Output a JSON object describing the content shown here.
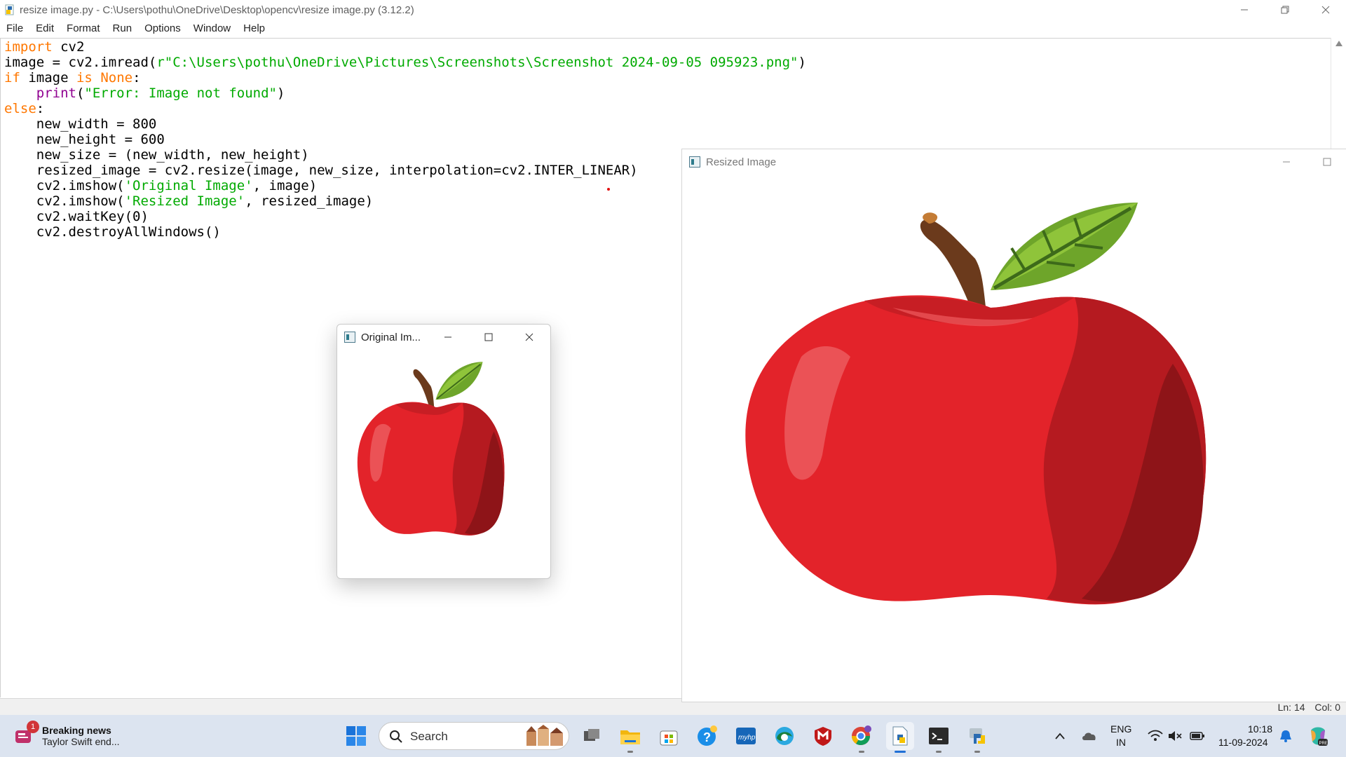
{
  "window": {
    "title": "resize image.py - C:\\Users\\pothu\\OneDrive\\Desktop\\opencv\\resize image.py (3.12.2)"
  },
  "menu": {
    "items": [
      "File",
      "Edit",
      "Format",
      "Run",
      "Options",
      "Window",
      "Help"
    ]
  },
  "editor": {
    "lines": [
      [
        {
          "t": "kw",
          "v": "import"
        },
        {
          "t": "",
          "v": " cv2"
        }
      ],
      [
        {
          "t": "",
          "v": "image = cv2.imread("
        },
        {
          "t": "str",
          "v": "r\"C:\\Users\\pothu\\OneDrive\\Pictures\\Screenshots\\Screenshot 2024-09-05 095923.png\""
        },
        {
          "t": "",
          "v": ")"
        }
      ],
      [
        {
          "t": "kw",
          "v": "if"
        },
        {
          "t": "",
          "v": " image "
        },
        {
          "t": "kw",
          "v": "is"
        },
        {
          "t": "",
          "v": " "
        },
        {
          "t": "kw",
          "v": "None"
        },
        {
          "t": "",
          "v": ":"
        }
      ],
      [
        {
          "t": "",
          "v": "    "
        },
        {
          "t": "bi",
          "v": "print"
        },
        {
          "t": "",
          "v": "("
        },
        {
          "t": "str",
          "v": "\"Error: Image not found\""
        },
        {
          "t": "",
          "v": ")"
        }
      ],
      [
        {
          "t": "kw",
          "v": "else"
        },
        {
          "t": "",
          "v": ":"
        }
      ],
      [
        {
          "t": "",
          "v": "    new_width = 800"
        }
      ],
      [
        {
          "t": "",
          "v": "    new_height = 600"
        }
      ],
      [
        {
          "t": "",
          "v": "    new_size = (new_width, new_height)"
        }
      ],
      [
        {
          "t": "",
          "v": "    resized_image = cv2.resize(image, new_size, interpolation=cv2.INTER_LINEAR)"
        }
      ],
      [
        {
          "t": "",
          "v": "    cv2.imshow("
        },
        {
          "t": "str",
          "v": "'Original Image'"
        },
        {
          "t": "",
          "v": ", image)"
        }
      ],
      [
        {
          "t": "",
          "v": "    cv2.imshow("
        },
        {
          "t": "str",
          "v": "'Resized Image'"
        },
        {
          "t": "",
          "v": ", resized_image)"
        }
      ],
      [
        {
          "t": "",
          "v": "    cv2.waitKey(0)"
        }
      ],
      [
        {
          "t": "",
          "v": "    cv2.destroyAllWindows()"
        }
      ]
    ]
  },
  "status": {
    "line": "Ln: 14",
    "col": "Col: 0"
  },
  "original_window": {
    "title": "Original Im..."
  },
  "resized_window": {
    "title": "Resized Image"
  },
  "taskbar": {
    "news_headline": "Breaking news",
    "news_sub": "Taylor Swift end...",
    "news_badge": "1",
    "search_label": "Search",
    "lang_top": "ENG",
    "lang_bottom": "IN",
    "time": "10:18",
    "date": "11-09-2024"
  },
  "colors": {
    "keyword": "#ff7700",
    "builtin": "#900090",
    "string": "#00aa00",
    "taskbar_bg": "#dce4f0",
    "apple_red": "#e3232a"
  }
}
